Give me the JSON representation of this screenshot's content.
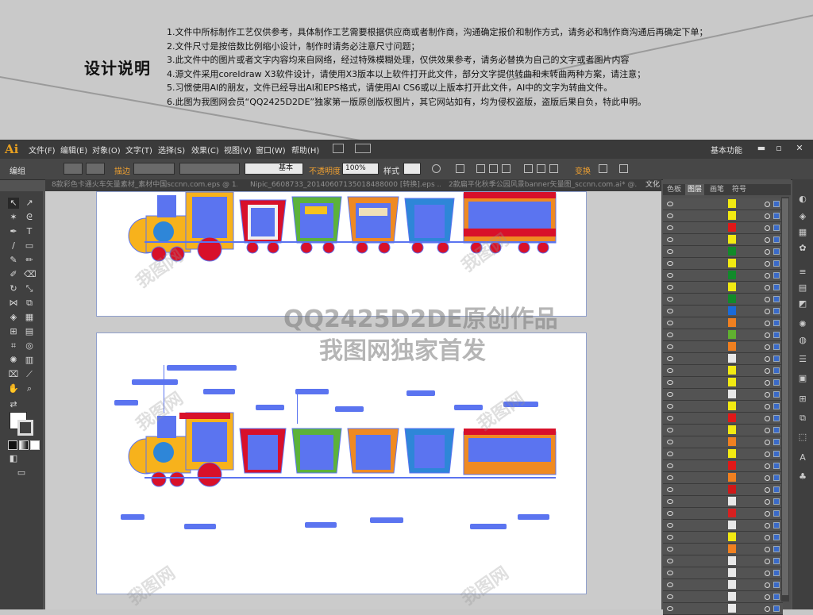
{
  "design_note": {
    "title": "设计说明",
    "lines": [
      "1.文件中所标制作工艺仅供参考，具体制作工艺需要根据供应商或者制作商，沟通确定报价和制作方式，请务必和制作商沟通后再确定下单；",
      "2.文件尺寸是按倍数比例缩小设计，制作时请务必注意尺寸问题；",
      "3.此文件中的图片或者文字内容均来自网络，经过特殊模糊处理，仅供效果参考，请务必替换为自己的文字或者图片内容",
      "4.源文件采用coreldraw X3软件设计，请使用X3版本以上软件打开此文件，部分文字提供转曲和未转曲两种方案，请注意；",
      "5.习惯使用AI的朋友，文件已经导出AI和EPS格式，请使用AI CS6或以上版本打开此文件，AI中的文字为转曲文件。",
      "6.此图为我图网会员“QQ2425D2DE”独家第一版原创版权图片，其它网站如有，均为侵权盗版，盗版后果自负，特此申明。"
    ]
  },
  "app": {
    "logo": "Ai",
    "menu": [
      "文件(F)",
      "编辑(E)",
      "对象(O)",
      "文字(T)",
      "选择(S)",
      "效果(C)",
      "视图(V)",
      "窗口(W)",
      "帮助(H)"
    ],
    "workspace": "基本功能",
    "window_buttons": [
      "▬",
      "▫",
      "✕"
    ]
  },
  "control_bar": {
    "selection": "编组",
    "stroke_label": "描边",
    "stroke_style": "基本",
    "opacity_label": "不透明度",
    "opacity_value": "100%",
    "style_label": "样式",
    "transform_label": "变换"
  },
  "tabs": [
    "8款彩色卡通火车矢量素材_素材中国sccnn.com.eps @ 1...",
    "Nipic_6608733_20140607135018488000 [转换].eps ...",
    "2款扁平化秋季公园风景banner矢量图_sccnn.com.ai* @...",
    "文化"
  ],
  "watermark": {
    "line1": "QQ2425D2DE原创作品",
    "line2": "我图网独家首发",
    "logo": "我图网"
  },
  "panel": {
    "tabs": [
      "色板",
      "图层",
      "画笔",
      "符号"
    ],
    "active_tab": "图层",
    "layer_colors": [
      "#f2ea12",
      "#f2ea12",
      "#e01818",
      "#f2ea12",
      "#118a2a",
      "#f2ea12",
      "#118a2a",
      "#f2ea12",
      "#118a2a",
      "#1a6ad8",
      "#f08020",
      "#60b030",
      "#f08020",
      "#e8e8e8",
      "#f2ea12",
      "#f2ea12",
      "#e8e8e8",
      "#f2ea12",
      "#e01818",
      "#f2ea12",
      "#f08020",
      "#f2ea12",
      "#e01818",
      "#f08020",
      "#d01818",
      "#e8e8e8",
      "#d82020",
      "#e8e8e8",
      "#f2ea12",
      "#f08020",
      "#e8e8e8",
      "#e8e8e8",
      "#e8e8e8",
      "#e8e8e8",
      "#e8e8e8"
    ]
  },
  "colors": {
    "annotation_blue": "#5b74f0",
    "train_red": "#d8102a",
    "train_green": "#5cb23a",
    "train_orange": "#ef8a22",
    "train_blue": "#2e86d8",
    "train_yellow": "#f7c21c"
  }
}
